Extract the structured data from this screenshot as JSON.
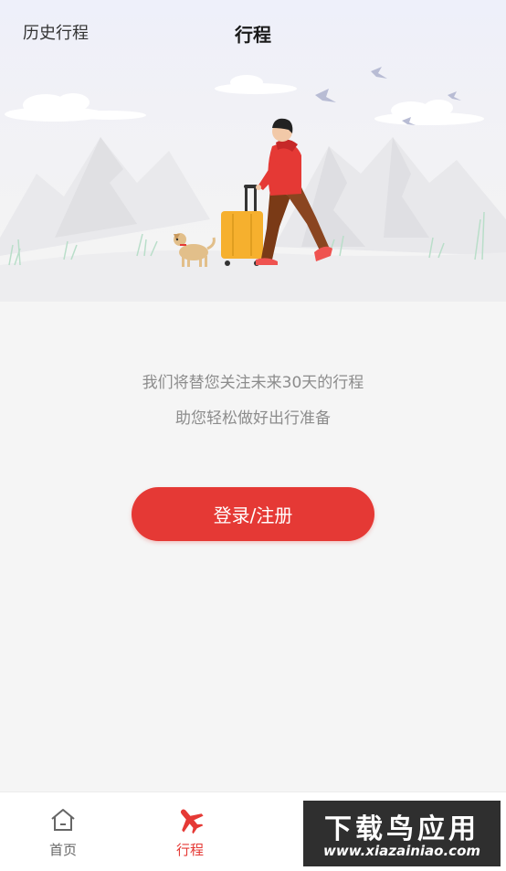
{
  "header": {
    "history_label": "历史行程",
    "title": "行程"
  },
  "main": {
    "desc_line1": "我们将替您关注未来30天的行程",
    "desc_line2": "助您轻松做好出行准备",
    "login_label": "登录/注册"
  },
  "tabbar": {
    "items": [
      {
        "label": "首页",
        "icon": "home-icon",
        "active": false
      },
      {
        "label": "行程",
        "icon": "airplane-icon",
        "active": true
      }
    ]
  },
  "watermark": {
    "main_text": "下载鸟应用",
    "sub_text": "www.xiazainiao.com"
  },
  "colors": {
    "accent": "#e53935",
    "background": "#f5f5f5",
    "text_muted": "#8c8c8c",
    "suitcase": "#f6b02e"
  }
}
